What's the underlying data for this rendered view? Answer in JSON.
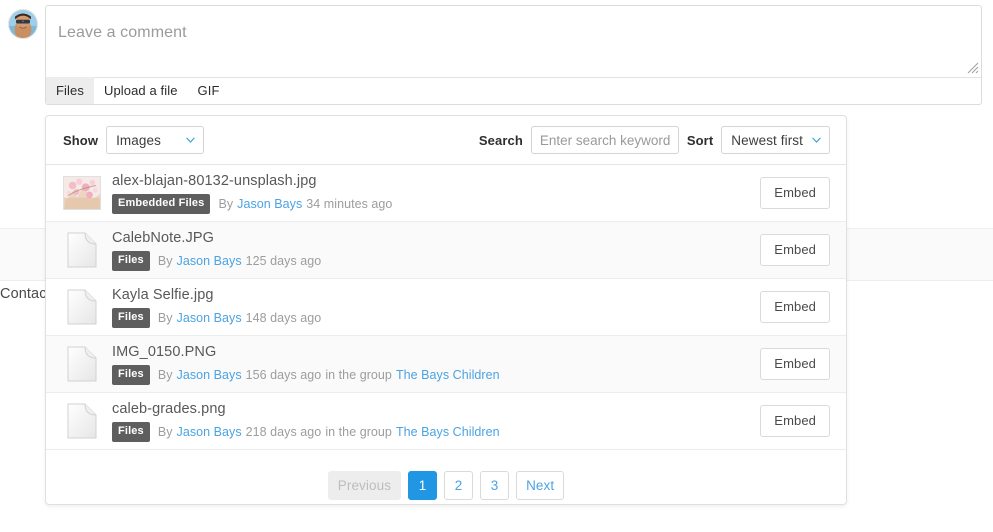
{
  "background": {
    "contact_label": "Contact"
  },
  "composer": {
    "avatar_name": "user-avatar",
    "placeholder": "Leave a comment",
    "tabs": [
      {
        "label": "Files",
        "active": true
      },
      {
        "label": "Upload a file",
        "active": false
      },
      {
        "label": "GIF",
        "active": false
      }
    ]
  },
  "filterbar": {
    "show_label": "Show",
    "show_value": "Images",
    "search_label": "Search",
    "search_value": "",
    "search_placeholder": "Enter search keyword...",
    "sort_label": "Sort",
    "sort_value": "Newest first"
  },
  "rows": [
    {
      "filename": "alex-blajan-80132-unsplash.jpg",
      "thumb": "image-thumbnail",
      "tag": "Embedded Files",
      "by": "By",
      "author": "Jason Bays",
      "when": "34 minutes ago",
      "group_prefix": "",
      "group": "",
      "action_label": "Embed"
    },
    {
      "filename": "CalebNote.JPG",
      "thumb": "file-icon",
      "tag": "Files",
      "by": "By",
      "author": "Jason Bays",
      "when": "125 days ago",
      "group_prefix": "",
      "group": "",
      "action_label": "Embed"
    },
    {
      "filename": "Kayla Selfie.jpg",
      "thumb": "file-icon",
      "tag": "Files",
      "by": "By",
      "author": "Jason Bays",
      "when": "148 days ago",
      "group_prefix": "",
      "group": "",
      "action_label": "Embed"
    },
    {
      "filename": "IMG_0150.PNG",
      "thumb": "file-icon",
      "tag": "Files",
      "by": "By",
      "author": "Jason Bays",
      "when": "156 days ago",
      "group_prefix": "in the group",
      "group": "The Bays Children",
      "action_label": "Embed"
    },
    {
      "filename": "caleb-grades.png",
      "thumb": "file-icon",
      "tag": "Files",
      "by": "By",
      "author": "Jason Bays",
      "when": "218 days ago",
      "group_prefix": "in the group",
      "group": "The Bays Children",
      "action_label": "Embed"
    }
  ],
  "pagination": {
    "previous_label": "Previous",
    "pages": [
      "1",
      "2",
      "3"
    ],
    "active_page": "1",
    "next_label": "Next"
  },
  "colors": {
    "accent": "#2196e3",
    "link": "#4ba3e3",
    "tag_bg": "#5e5e5e",
    "row_alt": "#fafafa"
  }
}
